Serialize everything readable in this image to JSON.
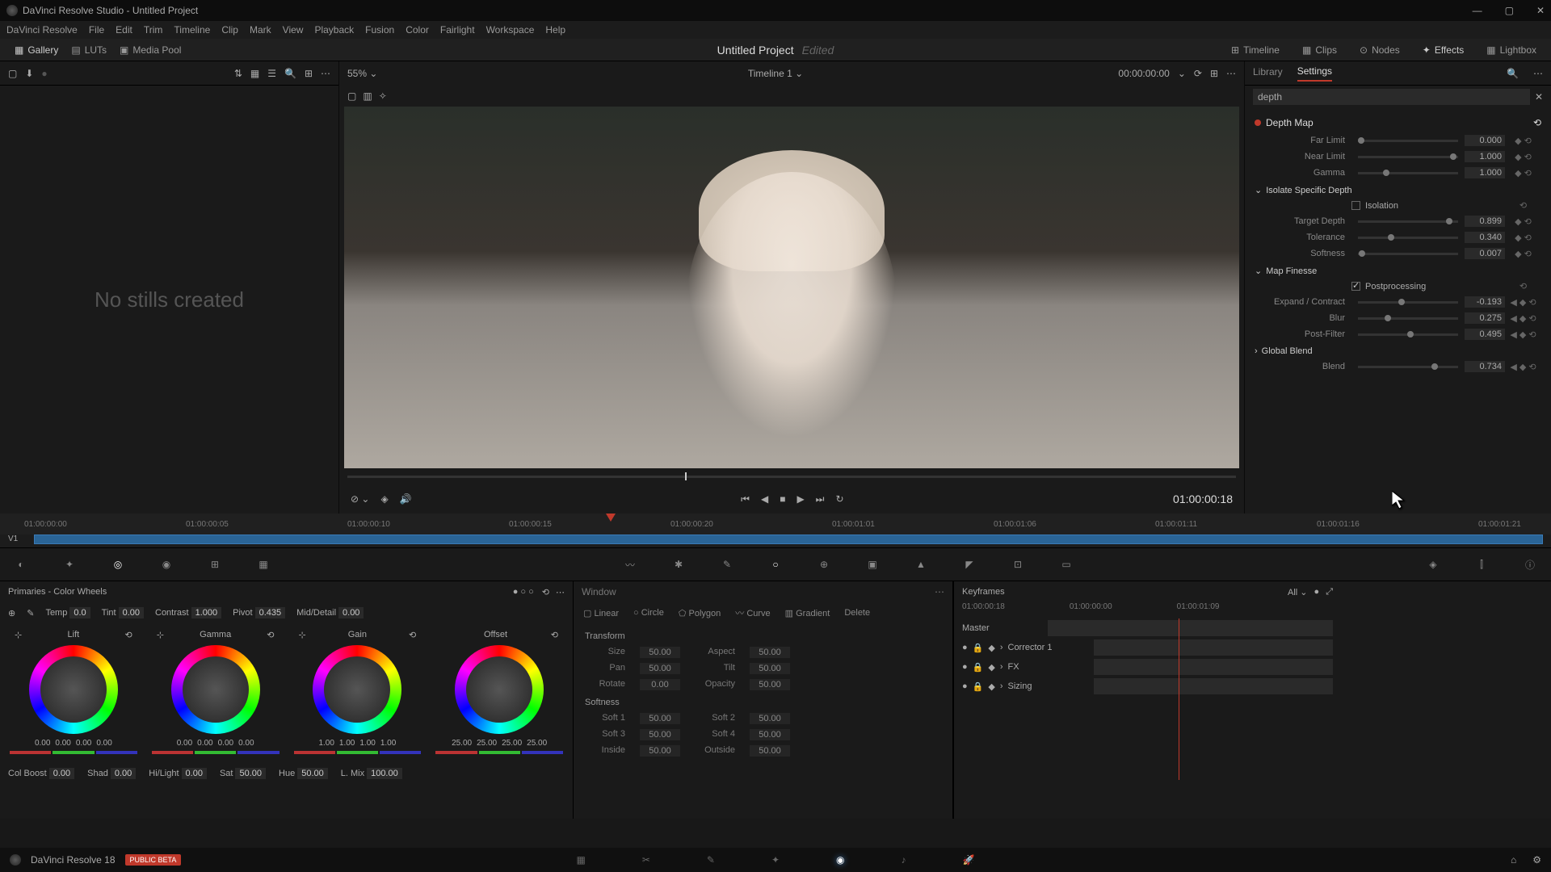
{
  "titlebar": {
    "title": "DaVinci Resolve Studio - Untitled Project"
  },
  "menubar": [
    "DaVinci Resolve",
    "File",
    "Edit",
    "Trim",
    "Timeline",
    "Clip",
    "Mark",
    "View",
    "Playback",
    "Fusion",
    "Color",
    "Fairlight",
    "Workspace",
    "Help"
  ],
  "toolbar": {
    "gallery": "Gallery",
    "luts": "LUTs",
    "media_pool": "Media Pool",
    "project": "Untitled Project",
    "edited": "Edited",
    "timeline_btn": "Timeline",
    "clips": "Clips",
    "nodes": "Nodes",
    "effects": "Effects",
    "lightbox": "Lightbox"
  },
  "gallery": {
    "no_stills": "No stills created"
  },
  "viewer": {
    "zoom": "55%",
    "timeline_name": "Timeline 1",
    "tc_head": "00:00:00:00",
    "tc_big": "01:00:00:18"
  },
  "settings": {
    "tabs": {
      "library": "Library",
      "settings": "Settings"
    },
    "search": "depth",
    "depth_map": "Depth Map",
    "far": {
      "label": "Far Limit",
      "val": "0.000"
    },
    "near": {
      "label": "Near Limit",
      "val": "1.000"
    },
    "gamma": {
      "label": "Gamma",
      "val": "1.000"
    },
    "isolate": "Isolate Specific Depth",
    "isolation": "Isolation",
    "target": {
      "label": "Target Depth",
      "val": "0.899"
    },
    "tolerance": {
      "label": "Tolerance",
      "val": "0.340"
    },
    "softness": {
      "label": "Softness",
      "val": "0.007"
    },
    "finesse": "Map Finesse",
    "post": "Postprocessing",
    "expand": {
      "label": "Expand / Contract",
      "val": "-0.193"
    },
    "blur": {
      "label": "Blur",
      "val": "0.275"
    },
    "postfilter": {
      "label": "Post-Filter",
      "val": "0.495"
    },
    "global": "Global Blend",
    "blend": {
      "label": "Blend",
      "val": "0.734"
    }
  },
  "ruler": [
    "01:00:00:00",
    "01:00:00:05",
    "01:00:00:10",
    "01:00:00:15",
    "01:00:00:20",
    "01:00:01:01",
    "01:00:01:06",
    "01:00:01:11",
    "01:00:01:16",
    "01:00:01:21"
  ],
  "track_label": "V1",
  "primaries": {
    "title": "Primaries - Color Wheels",
    "temp": "Temp",
    "temp_v": "0.0",
    "tint": "Tint",
    "tint_v": "0.00",
    "contrast": "Contrast",
    "contrast_v": "1.000",
    "pivot": "Pivot",
    "pivot_v": "0.435",
    "md": "Mid/Detail",
    "md_v": "0.00",
    "lift": "Lift",
    "gamma_w": "Gamma",
    "gain": "Gain",
    "offset": "Offset",
    "lift_vals": [
      "0.00",
      "0.00",
      "0.00",
      "0.00"
    ],
    "gamma_vals": [
      "0.00",
      "0.00",
      "0.00",
      "0.00"
    ],
    "gain_vals": [
      "1.00",
      "1.00",
      "1.00",
      "1.00"
    ],
    "offset_vals": [
      "25.00",
      "25.00",
      "25.00",
      "25.00"
    ],
    "colboost": "Col Boost",
    "colboost_v": "0.00",
    "shad": "Shad",
    "shad_v": "0.00",
    "hilight": "Hi/Light",
    "hilight_v": "0.00",
    "sat": "Sat",
    "sat_v": "50.00",
    "hue": "Hue",
    "hue_v": "50.00",
    "lmix": "L. Mix",
    "lmix_v": "100.00"
  },
  "window": {
    "title": "Window",
    "linear": "Linear",
    "circle": "Circle",
    "polygon": "Polygon",
    "curve": "Curve",
    "gradient": "Gradient",
    "delete": "Delete"
  },
  "xform": {
    "transform": "Transform",
    "size": "Size",
    "size_v": "50.00",
    "aspect": "Aspect",
    "aspect_v": "50.00",
    "pan": "Pan",
    "pan_v": "50.00",
    "tilt": "Tilt",
    "tilt_v": "50.00",
    "rotate": "Rotate",
    "rotate_v": "0.00",
    "opacity": "Opacity",
    "opacity_v": "50.00",
    "softness": "Softness",
    "s1": "Soft 1",
    "s1_v": "50.00",
    "s2": "Soft 2",
    "s2_v": "50.00",
    "s3": "Soft 3",
    "s3_v": "50.00",
    "s4": "Soft 4",
    "s4_v": "50.00",
    "inside": "Inside",
    "inside_v": "50.00",
    "outside": "Outside",
    "outside_v": "50.00"
  },
  "keyframes": {
    "title": "Keyframes",
    "all": "All",
    "tc": "01:00:00:18",
    "tc1": "01:00:00:00",
    "tc2": "01:00:01:09",
    "master": "Master",
    "corrector": "Corrector 1",
    "fx": "FX",
    "sizing": "Sizing"
  },
  "bottom": {
    "app": "DaVinci Resolve 18",
    "beta": "PUBLIC BETA"
  }
}
